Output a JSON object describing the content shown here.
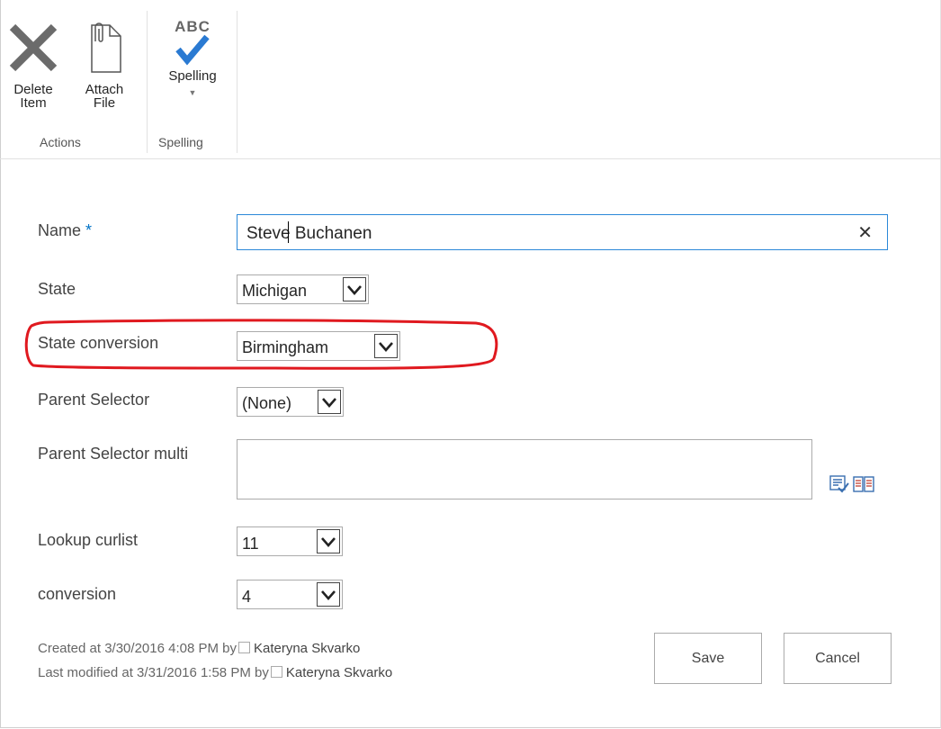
{
  "ribbon": {
    "delete_label_1": "Delete",
    "delete_label_2": "Item",
    "attach_label_1": "Attach",
    "attach_label_2": "File",
    "spelling_label": "Spelling",
    "spelling_abc": "ABC",
    "group_actions": "Actions",
    "group_spelling": "Spelling"
  },
  "form": {
    "name_label": "Name",
    "required_mark": "*",
    "name_value": "Steve Buchanen",
    "clear_glyph": "✕",
    "state_label": "State",
    "state_value": "Michigan",
    "state_conversion_label": "State conversion",
    "state_conversion_value": "Birmingham",
    "parent_selector_label": "Parent Selector",
    "parent_selector_value": "(None)",
    "parent_selector_multi_label": "Parent Selector multi",
    "lookup_curlist_label": "Lookup curlist",
    "lookup_curlist_value": "11",
    "conversion_label": "conversion",
    "conversion_value": "4"
  },
  "footer": {
    "created_prefix": "Created at 3/30/2016 4:08 PM  by",
    "created_user": "Kateryna Skvarko",
    "modified_prefix": "Last modified at 3/31/2016 1:58 PM  by",
    "modified_user": "Kateryna Skvarko",
    "save_label": "Save",
    "cancel_label": "Cancel"
  },
  "colors": {
    "accent": "#0072c6",
    "highlight_outline": "#e0191f",
    "spell_check": "#2a7ad2"
  }
}
